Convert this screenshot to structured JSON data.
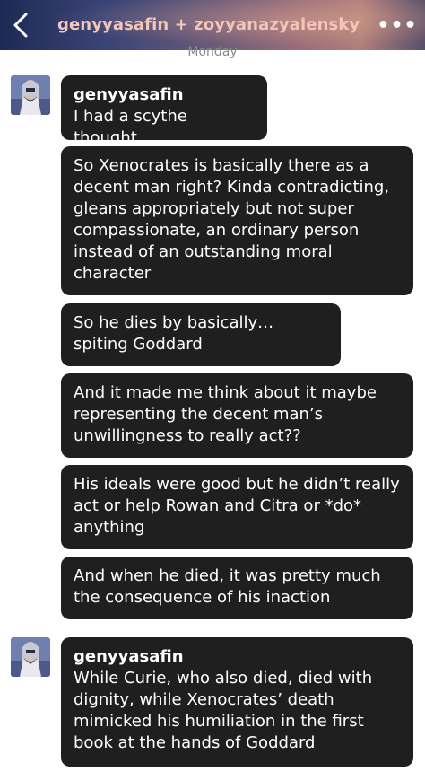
{
  "header": {
    "title": "genyyasafin + zoyyanazyalensky",
    "back_icon": "chevron-left-icon",
    "more_icon": "more-horizontal-icon",
    "more_label": "•••"
  },
  "day_label": "Monday",
  "messages": [
    {
      "sender": "genyyasafin",
      "text": "I had a scythe thought"
    },
    {
      "text": "So Xenocrates is basically there as a decent man right? Kinda contradicting, gleans appropriately but not super compassionate, an ordinary person instead of an outstanding moral character"
    },
    {
      "text": "So he dies by basically… spiting Goddard"
    },
    {
      "text": "And it made me think about it maybe representing the decent man’s unwillingness to really act??"
    },
    {
      "text": "His ideals were good but he didn’t really act or help Rowan and Citra or *do* anything"
    },
    {
      "text": "And when he died, it was pretty much the consequence of his inaction"
    },
    {
      "sender": "genyyasafin",
      "text": "While Curie, who also died, died with dignity, while Xenocrates’ death mimicked his humiliation in the first book at the hands of Goddard"
    }
  ]
}
